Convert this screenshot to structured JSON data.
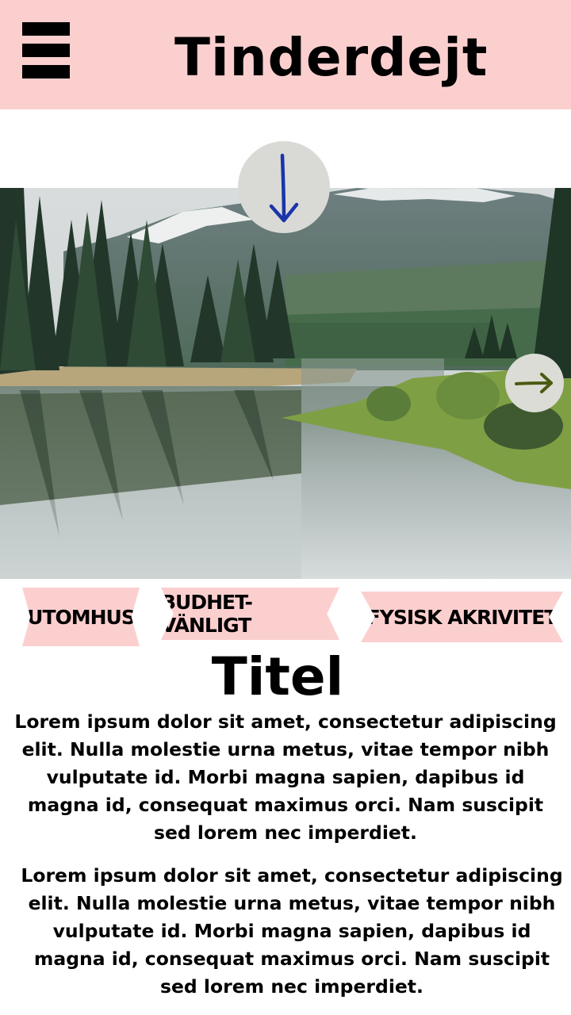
{
  "header": {
    "title": "Tinderdejt",
    "menu_icon": "hamburger-menu-icon",
    "background": "#fccfcf"
  },
  "hero": {
    "scroll_down_icon": "arrow-down-icon",
    "next_icon": "arrow-right-icon",
    "scroll_down_color": "#1a35a8",
    "next_color": "#4a5a12"
  },
  "tags": [
    {
      "label": "UTOMHUS"
    },
    {
      "label": "BUDHET-VÄNLIGT"
    },
    {
      "label": "FYSISK AKRIVITET"
    }
  ],
  "article": {
    "title": "Titel",
    "paragraphs": [
      "Lorem ipsum dolor sit amet, consectetur adipiscing elit. Nulla molestie urna metus, vitae tempor nibh vulputate id. Morbi magna sapien, dapibus id magna id, consequat maximus orci. Nam suscipit sed lorem nec imperdiet.",
      "Lorem ipsum dolor sit amet, consectetur adipiscing elit. Nulla molestie urna metus, vitae tempor nibh vulputate id. Morbi magna sapien, dapibus id magna id, consequat maximus orci. Nam suscipit sed lorem nec imperdiet."
    ]
  }
}
